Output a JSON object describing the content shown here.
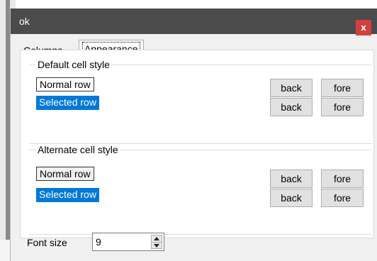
{
  "dialog": {
    "title": "ok",
    "close_glyph": "x"
  },
  "tabs": [
    {
      "label": "Columns",
      "active": false
    },
    {
      "label": "Appearance",
      "active": true
    }
  ],
  "default_group": {
    "title": "Default cell style",
    "normal_row": "Normal row",
    "selected_row": "Selected row",
    "back_label": "back",
    "fore_label": "fore"
  },
  "alternate_group": {
    "title": "Alternate cell style",
    "normal_row": "Normal row",
    "selected_row": "Selected row",
    "back_label": "back",
    "fore_label": "fore"
  },
  "font_size": {
    "label": "Font size",
    "value": "9"
  },
  "colors": {
    "title_bar": "#4b4b4b",
    "close_button": "#d13f3f",
    "selection": "#0078d7"
  },
  "icons": [
    "close-icon",
    "spin-up-icon",
    "spin-down-icon"
  ]
}
